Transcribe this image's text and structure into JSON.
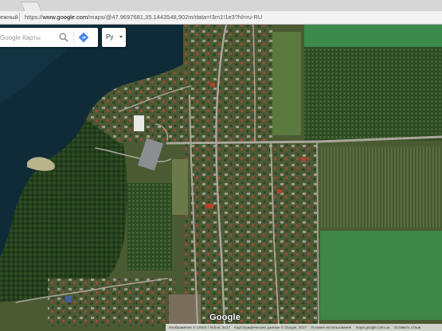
{
  "browser": {
    "tab_left_label": "ежный",
    "url": {
      "prefix": "https://",
      "host": "www.google.com",
      "path": "/maps/@47.9697681,35.1443548,902m/data=!3m1!1e3?hl=ru-RU"
    }
  },
  "search": {
    "placeholder": "Google Карты",
    "search_icon": "magnifier-icon",
    "directions_icon": "directions-icon"
  },
  "language": {
    "selected": "Ру"
  },
  "map": {
    "type": "satellite",
    "water_color": "#0f2b38",
    "field_light_color": "#3b8a4c",
    "road_color": "#a9a79b"
  },
  "footer": {
    "logo": "Google",
    "imagery": "Изображения © CNES / Airbus, 2017",
    "map_data": "Картографические данные © Google, 2017",
    "terms": "Условия использования",
    "domain": "maps.google.com.ua",
    "feedback": "Оставить отзыв"
  }
}
